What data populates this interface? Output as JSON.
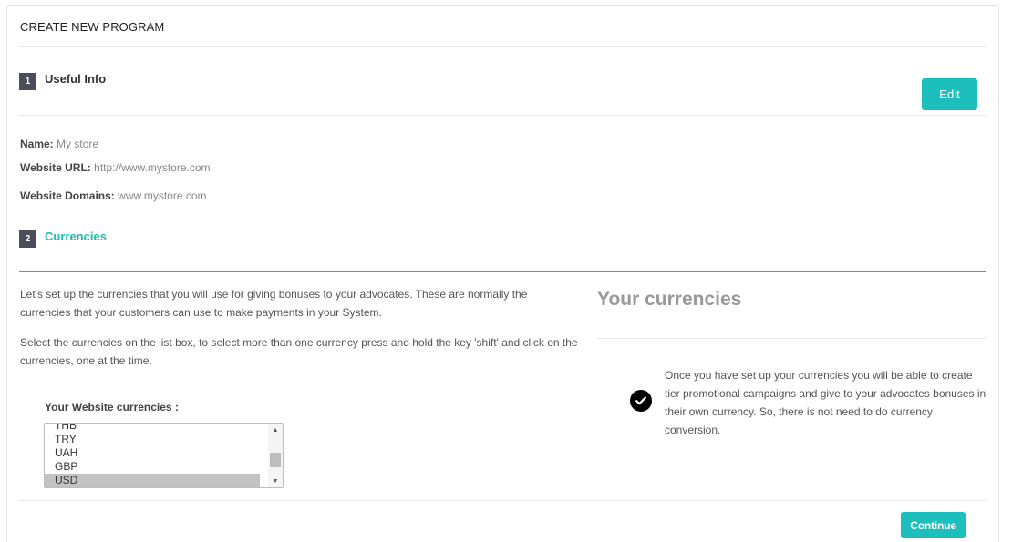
{
  "header": {
    "title": "CREATE NEW PROGRAM"
  },
  "step1": {
    "number": "1",
    "label": "Useful Info",
    "edit_label": "Edit",
    "fields": [
      {
        "key": "Name:",
        "value": "My store"
      },
      {
        "key": "Website URL:",
        "value": "http://www.mystore.com"
      },
      {
        "key": "Website Domains:",
        "value": "www.mystore.com"
      }
    ]
  },
  "step2": {
    "number": "2",
    "label": "Currencies",
    "intro": "Let's set up the currencies that you will use for giving bonuses to your advocates. These are normally the currencies that your customers can use to make payments in your System.",
    "instructions": "Select the currencies on the list box, to select more than one currency press and hold the key 'shift' and click on the currencies, one at the time.",
    "list_label": "Your Website currencies :",
    "currencies": [
      "THB",
      "TRY",
      "UAH",
      "GBP",
      "USD"
    ],
    "selected": "USD",
    "side_title": "Your currencies",
    "side_note": "Once you have set up your currencies you will be able to create tier promotional campaigns and give to your advocates bonuses in their own currency. So, there is not need to do currency conversion.",
    "check_icon": "check-circle-icon"
  },
  "footer": {
    "continue_label": "Continue"
  },
  "colors": {
    "accent": "#1cbfbb",
    "step_badge": "#4a4e59"
  }
}
